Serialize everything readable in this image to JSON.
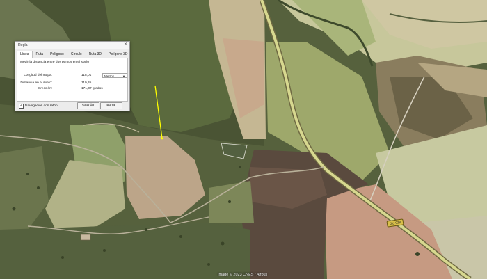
{
  "dialog": {
    "title": "Regla",
    "tabs": [
      "Línea",
      "Ruta",
      "Polígono",
      "Círculo",
      "Ruta 3D",
      "Polígono 3D"
    ],
    "active_tab": "Línea",
    "description": "Medir la distancia entre dos puntos en el suelo",
    "map_length_label": "Longitud del mapa:",
    "map_length_value": "118,01",
    "units_selected": "Metros",
    "ground_length_label": "Distancia en el suelo:",
    "ground_length_value": "119,35",
    "heading_label": "Dirección:",
    "heading_value": "171,07 grados",
    "mouse_nav_label": "Navegación con ratón",
    "mouse_nav_checked": true,
    "save_label": "Guardar",
    "clear_label": "Borrar"
  },
  "map": {
    "road_label": "GU-928",
    "attribution": "Image © 2023 CNES / Airbus"
  },
  "colors": {
    "measure_line": "#ffff00",
    "road": "#d7d88f"
  }
}
